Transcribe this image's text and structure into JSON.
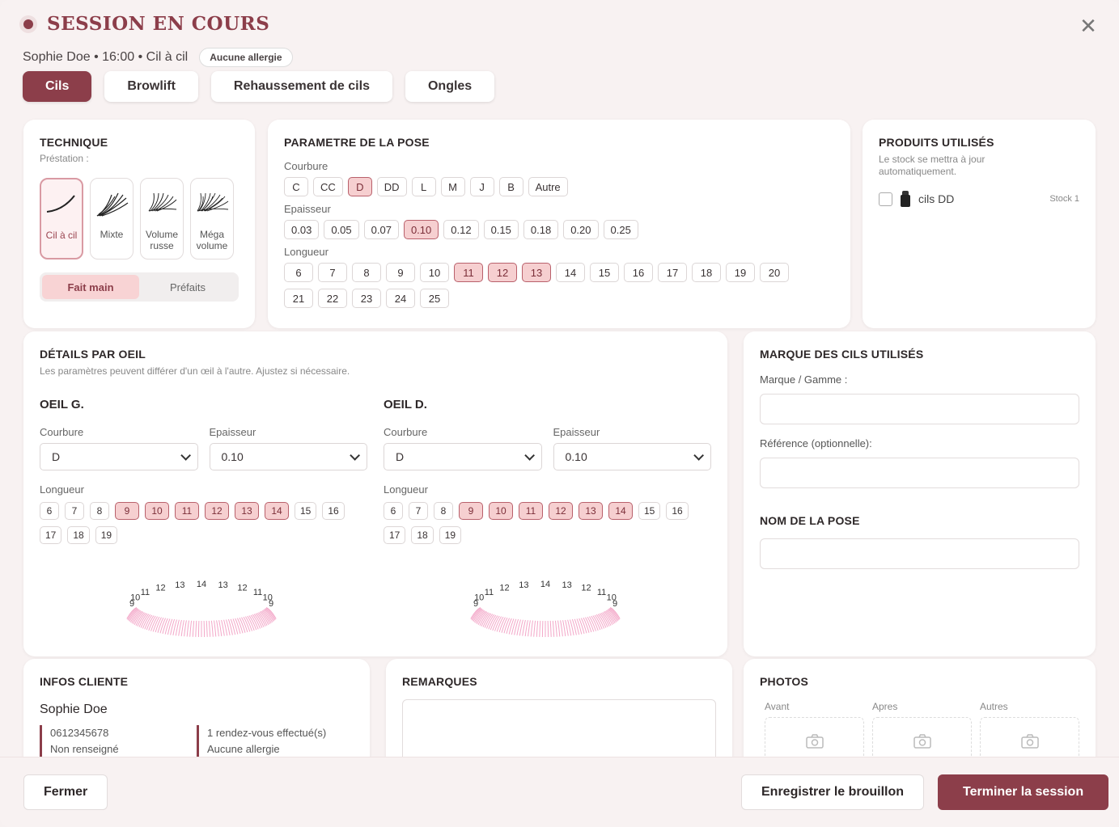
{
  "header": {
    "title": "SESSION EN COURS",
    "subtitle": "Sophie Doe • 16:00 • Cil à cil",
    "allergy_badge": "Aucune allergie",
    "close_glyph": "✕"
  },
  "tabs": [
    {
      "label": "Cils",
      "active": true
    },
    {
      "label": "Browlift",
      "active": false
    },
    {
      "label": "Rehaussement de cils",
      "active": false
    },
    {
      "label": "Ongles",
      "active": false
    }
  ],
  "technique": {
    "title": "TECHNIQUE",
    "subtitle": "Préstation :",
    "items": [
      {
        "label": "Cil à cil",
        "active": true
      },
      {
        "label": "Mixte",
        "active": false
      },
      {
        "label": "Volume russe",
        "active": false
      },
      {
        "label": "Méga volume",
        "active": false
      }
    ],
    "segment": [
      {
        "label": "Fait main",
        "active": true
      },
      {
        "label": "Préfaits",
        "active": false
      }
    ]
  },
  "pose": {
    "title": "PARAMETRE DE LA POSE",
    "courbure_label": "Courbure",
    "courbure": [
      "C",
      "CC",
      "D",
      "DD",
      "L",
      "M",
      "J",
      "B",
      "Autre"
    ],
    "courbure_selected": [
      "D"
    ],
    "epaisseur_label": "Epaisseur",
    "epaisseur": [
      "0.03",
      "0.05",
      "0.07",
      "0.10",
      "0.12",
      "0.15",
      "0.18",
      "0.20",
      "0.25"
    ],
    "epaisseur_selected": [
      "0.10"
    ],
    "longueur_label": "Longueur",
    "longueur": [
      "6",
      "7",
      "8",
      "9",
      "10",
      "11",
      "12",
      "13",
      "14",
      "15",
      "16",
      "17",
      "18",
      "19",
      "20",
      "21",
      "22",
      "23",
      "24",
      "25"
    ],
    "longueur_selected": [
      "11",
      "12",
      "13"
    ]
  },
  "produits": {
    "title": "PRODUITS UTILISÉS",
    "subtitle": "Le stock se mettra à jour automatiquement.",
    "items": [
      {
        "name": "cils DD",
        "stock": "Stock 1"
      }
    ]
  },
  "details": {
    "title": "DÉTAILS PAR OEIL",
    "subtitle": "Les paramètres peuvent différer d'un œil à l'autre. Ajustez si nécessaire.",
    "eyes": [
      {
        "title": "OEIL G.",
        "courbure_label": "Courbure",
        "courbure_value": "D",
        "epaisseur_label": "Epaisseur",
        "epaisseur_value": "0.10",
        "longueur_label": "Longueur",
        "longueur": [
          "6",
          "7",
          "8",
          "9",
          "10",
          "11",
          "12",
          "13",
          "14",
          "15",
          "16",
          "17",
          "18",
          "19"
        ],
        "longueur_selected": [
          "9",
          "10",
          "11",
          "12",
          "13",
          "14"
        ],
        "map_labels": [
          "9",
          "10",
          "11",
          "12",
          "13",
          "14",
          "13",
          "12",
          "11",
          "10",
          "9"
        ]
      },
      {
        "title": "OEIL D.",
        "courbure_label": "Courbure",
        "courbure_value": "D",
        "epaisseur_label": "Epaisseur",
        "epaisseur_value": "0.10",
        "longueur_label": "Longueur",
        "longueur": [
          "6",
          "7",
          "8",
          "9",
          "10",
          "11",
          "12",
          "13",
          "14",
          "15",
          "16",
          "17",
          "18",
          "19"
        ],
        "longueur_selected": [
          "9",
          "10",
          "11",
          "12",
          "13",
          "14"
        ],
        "map_labels": [
          "9",
          "10",
          "11",
          "12",
          "13",
          "14",
          "13",
          "12",
          "11",
          "10",
          "9"
        ]
      }
    ]
  },
  "marque": {
    "title": "MARQUE DES CILS UTILISÉS",
    "marque_label": "Marque / Gamme :",
    "reference_label": "Référence (optionnelle):",
    "nom_title": "NOM DE LA POSE"
  },
  "infos": {
    "title": "INFOS CLIENTE",
    "name": "Sophie Doe",
    "phone": "0612345678",
    "status": "Non renseigné",
    "visits": "1 rendez-vous effectué(s)",
    "allergy": "Aucune allergie"
  },
  "remarques": {
    "title": "REMARQUES"
  },
  "photos": {
    "title": "PHOTOS",
    "slots": [
      "Avant",
      "Apres",
      "Autres"
    ]
  },
  "footer": {
    "close": "Fermer",
    "draft": "Enregistrer le brouillon",
    "finish": "Terminer la session"
  },
  "colors": {
    "accent": "#8c3e4a",
    "selected_bg": "#f6cfd0",
    "lash_pink": "#f3a7c8"
  }
}
